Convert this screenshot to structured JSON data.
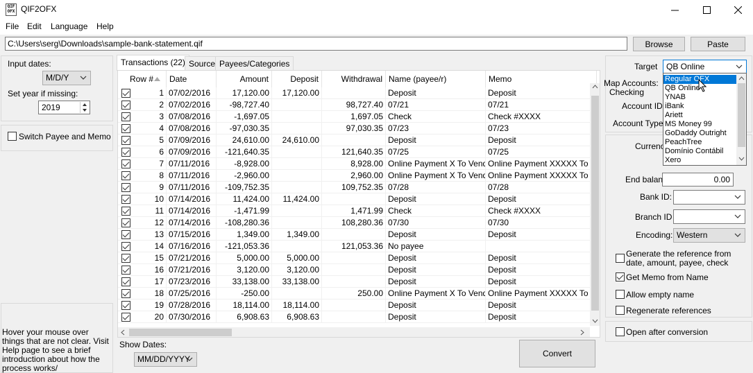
{
  "window": {
    "title": "QIF2OFX"
  },
  "menu": [
    "File",
    "Edit",
    "Language",
    "Help"
  ],
  "path": {
    "value": "C:\\Users\\serg\\Downloads\\sample-bank-statement.qif",
    "browse": "Browse",
    "paste": "Paste"
  },
  "left": {
    "input_dates_label": "Input dates:",
    "input_dates_value": "M/D/Y",
    "year_label": "Set year if missing:",
    "year_value": "2019",
    "switch_label": "Switch Payee and Memo",
    "help_text": "Hover your mouse over things that are not clear. Visit Help page to see a brief introduction about how the process works/"
  },
  "tabs": [
    "Transactions (22)",
    "Source",
    "Payees/Categories"
  ],
  "table": {
    "columns": [
      "Row #",
      "Date",
      "Amount",
      "Deposit",
      "Withdrawal",
      "Name (payee/r)",
      "Memo"
    ],
    "rows": [
      [
        "1",
        "07/02/2016",
        "17,120.00",
        "17,120.00",
        "",
        "Deposit",
        "Deposit"
      ],
      [
        "2",
        "07/02/2016",
        "-98,727.40",
        "",
        "98,727.40",
        "07/21",
        "07/21"
      ],
      [
        "3",
        "07/08/2016",
        "-1,697.05",
        "",
        "1,697.05",
        "Check",
        "Check #XXXX"
      ],
      [
        "4",
        "07/08/2016",
        "-97,030.35",
        "",
        "97,030.35",
        "07/23",
        "07/23"
      ],
      [
        "5",
        "07/09/2016",
        "24,610.00",
        "24,610.00",
        "",
        "Deposit",
        "Deposit"
      ],
      [
        "6",
        "07/09/2016",
        "-121,640.35",
        "",
        "121,640.35",
        "07/25",
        "07/25"
      ],
      [
        "7",
        "07/11/2016",
        "-8,928.00",
        "",
        "8,928.00",
        "Online Payment X To Vendor",
        "Online Payment XXXXX To Vendo"
      ],
      [
        "8",
        "07/11/2016",
        "-2,960.00",
        "",
        "2,960.00",
        "Online Payment X To Vendor",
        "Online Payment XXXXX To Vendo"
      ],
      [
        "9",
        "07/11/2016",
        "-109,752.35",
        "",
        "109,752.35",
        "07/28",
        "07/28"
      ],
      [
        "10",
        "07/14/2016",
        "11,424.00",
        "11,424.00",
        "",
        "Deposit",
        "Deposit"
      ],
      [
        "11",
        "07/14/2016",
        "-1,471.99",
        "",
        "1,471.99",
        "Check",
        "Check #XXXX"
      ],
      [
        "12",
        "07/14/2016",
        "-108,280.36",
        "",
        "108,280.36",
        "07/30",
        "07/30"
      ],
      [
        "13",
        "07/15/2016",
        "1,349.00",
        "1,349.00",
        "",
        "Deposit",
        "Deposit"
      ],
      [
        "14",
        "07/16/2016",
        "-121,053.36",
        "",
        "121,053.36",
        "No payee",
        ""
      ],
      [
        "15",
        "07/21/2016",
        "5,000.00",
        "5,000.00",
        "",
        "Deposit",
        "Deposit"
      ],
      [
        "16",
        "07/21/2016",
        "3,120.00",
        "3,120.00",
        "",
        "Deposit",
        "Deposit"
      ],
      [
        "17",
        "07/23/2016",
        "33,138.00",
        "33,138.00",
        "",
        "Deposit",
        "Deposit"
      ],
      [
        "18",
        "07/25/2016",
        "-250.00",
        "",
        "250.00",
        "Online Payment X To Vendor",
        "Online Payment XXXXX To Vendo"
      ],
      [
        "19",
        "07/28/2016",
        "18,114.00",
        "18,114.00",
        "",
        "Deposit",
        "Deposit"
      ],
      [
        "20",
        "07/30/2016",
        "6,908.63",
        "6,908.63",
        "",
        "Deposit",
        "Deposit"
      ]
    ]
  },
  "bottom": {
    "show_dates_label": "Show Dates:",
    "show_dates_value": "MM/DD/YYYY",
    "convert": "Convert"
  },
  "right": {
    "target_label": "Target",
    "target_value": "QB Online",
    "map_accounts_label": "Map Accounts:",
    "checking_label": "Checking",
    "account_id_label": "Account ID:",
    "account_type_label": "Account Type:",
    "currency_label": "Currenc",
    "end_balance_label": "End balanc",
    "end_balance_value": "0.00",
    "bank_id_label": "Bank ID:",
    "branch_id_label": "Branch ID",
    "encoding_label": "Encoding:",
    "encoding_value": "Western",
    "gen_ref_label": "Generate the reference from date, amount, payee, check",
    "memo_from_name_label": "Get Memo from Name",
    "allow_empty_label": "Allow empty name",
    "regen_label": "Regenerate references",
    "open_after_label": "Open after conversion"
  },
  "dropdown": {
    "options": [
      "Regular OFX",
      "QB Online",
      "YNAB",
      "iBank",
      "Ariett",
      "MS Money 99",
      "GoDaddy Outright",
      "PeachTree",
      "Domínio Contábil",
      "Xero"
    ],
    "highlighted": 0
  }
}
